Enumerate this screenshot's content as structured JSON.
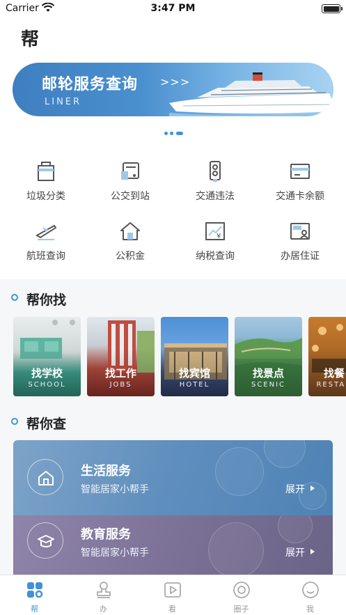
{
  "status_bar": {
    "carrier": "Carrier",
    "time": "3:47 PM"
  },
  "page": {
    "title": "帮"
  },
  "banner": {
    "title": "邮轮服务查询",
    "arrows": ">>>",
    "subtitle": "LINER"
  },
  "services_grid": [
    {
      "label": "垃圾分类",
      "icon": "trash-bin-icon"
    },
    {
      "label": "公交到站",
      "icon": "bus-icon"
    },
    {
      "label": "交通违法",
      "icon": "traffic-light-icon"
    },
    {
      "label": "交通卡余额",
      "icon": "card-icon"
    },
    {
      "label": "航班查询",
      "icon": "airplane-icon"
    },
    {
      "label": "公积金",
      "icon": "house-icon"
    },
    {
      "label": "纳税查询",
      "icon": "tax-chart-icon"
    },
    {
      "label": "办居住证",
      "icon": "id-card-icon"
    }
  ],
  "find_section": {
    "title": "帮你找",
    "cards": [
      {
        "name": "找学校",
        "en": "SCHOOL"
      },
      {
        "name": "找工作",
        "en": "JOBS"
      },
      {
        "name": "找宾馆",
        "en": "HOTEL"
      },
      {
        "name": "找景点",
        "en": "SCENIC"
      },
      {
        "name": "找餐",
        "en": "RESTAU"
      }
    ]
  },
  "query_section": {
    "title": "帮你查",
    "services": [
      {
        "title": "生活服务",
        "subtitle": "智能居家小帮手",
        "action": "展开",
        "icon": "home-icon"
      },
      {
        "title": "教育服务",
        "subtitle": "智能居家小帮手",
        "action": "展开",
        "icon": "graduation-cap-icon"
      }
    ]
  },
  "tabbar": {
    "active": 0,
    "items": [
      {
        "label": "帮",
        "icon": "grid-apps-icon"
      },
      {
        "label": "办",
        "icon": "stamp-icon"
      },
      {
        "label": "看",
        "icon": "play-icon"
      },
      {
        "label": "圈子",
        "icon": "circle-icon"
      },
      {
        "label": "我",
        "icon": "smile-icon"
      }
    ]
  },
  "colors": {
    "accent": "#3f93d3",
    "text": "#333333",
    "background": "#f6f7f9"
  }
}
